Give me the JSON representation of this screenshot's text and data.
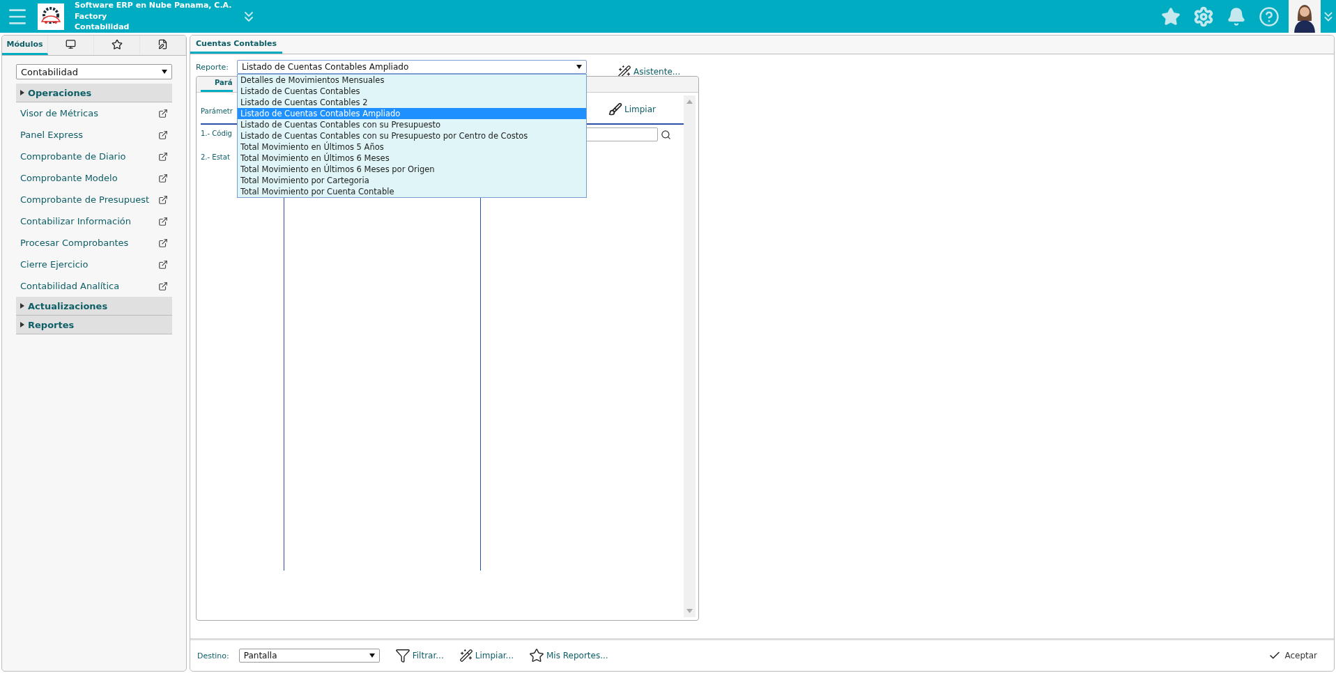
{
  "header": {
    "company": "Software ERP en Nube Panama, C.A.",
    "branch": "Factory",
    "module": "Contabilidad"
  },
  "sidebar": {
    "tabs": [
      {
        "kind": "text",
        "label": "Módulos",
        "selected": true
      },
      {
        "kind": "monitor",
        "selected": false
      },
      {
        "kind": "star",
        "selected": false
      },
      {
        "kind": "note",
        "selected": false
      }
    ],
    "module_select": "Contabilidad",
    "sections": [
      {
        "title": "Operaciones",
        "items": [
          "Visor de Métricas",
          "Panel Express",
          "Comprobante de Diario",
          "Comprobante Modelo",
          "Comprobante de Presupuest",
          "Contabilizar Información",
          "Procesar Comprobantes",
          "Cierre Ejercicio",
          "Contabilidad Analítica"
        ]
      },
      {
        "title": "Actualizaciones"
      },
      {
        "title": "Reportes"
      }
    ]
  },
  "main": {
    "tabs": [
      {
        "label": "Cuentas Contables",
        "selected": true
      }
    ],
    "report_label": "Reporte:",
    "report_value": "Listado de Cuentas Contables Ampliado",
    "wizard": "Asistente...",
    "report_options": [
      {
        "label": "Detalles de Movimientos Mensuales",
        "selected": false
      },
      {
        "label": "Listado de Cuentas Contables",
        "selected": false
      },
      {
        "label": "Listado de Cuentas Contables 2",
        "selected": false
      },
      {
        "label": "Listado de Cuentas Contables Ampliado",
        "selected": true
      },
      {
        "label": "Listado de Cuentas Contables con su Presupuesto",
        "selected": false
      },
      {
        "label": "Listado de Cuentas Contables con su Presupuesto por Centro de Costos",
        "selected": false
      },
      {
        "label": "Total Movimiento en Últimos 5 Años",
        "selected": false
      },
      {
        "label": "Total Movimiento en Últimos 6 Meses",
        "selected": false
      },
      {
        "label": "Total Movimiento en Últimos 6 Meses por Origen",
        "selected": false
      },
      {
        "label": "Total Movimiento por Cartegoria",
        "selected": false
      },
      {
        "label": "Total Movimiento por Cuenta Contable",
        "selected": false
      }
    ],
    "inner_tab": "Pará",
    "params_label": "Parámetr",
    "clear": "Limpiar",
    "params": [
      "1.- Códig",
      "2.- Estat"
    ]
  },
  "footer": {
    "destino_label": "Destino:",
    "destino_value": "Pantalla",
    "buttons": [
      {
        "kind": "filter",
        "label": "Filtrar..."
      },
      {
        "kind": "wizard",
        "label": "Limpiar..."
      },
      {
        "kind": "star",
        "label": "Mis Reportes..."
      }
    ],
    "accept": "Aceptar"
  }
}
